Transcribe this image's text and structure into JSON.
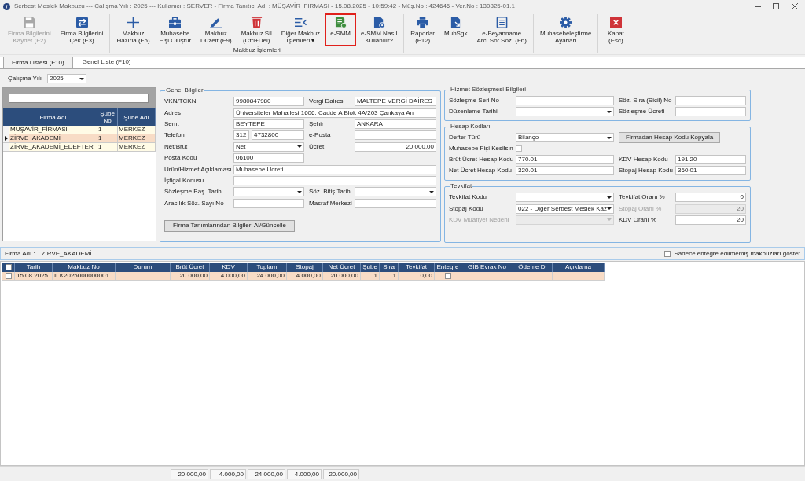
{
  "window": {
    "title": "Serbest Meslek Makbuzu --- Çalışma Yılı : 2025 --- Kullanıcı : SERVER - Firma Tanıtıcı Adı : MÜŞAVİR_FIRMASI - 15.08.2025 - 10:59:42 - Müş.No : 424646 - Ver.No : 130825-01.1"
  },
  "toolbar": {
    "groups": [
      {
        "buttons": [
          {
            "lines": [
              "Firma Bilgilerini",
              "Kaydet (F2)"
            ],
            "disabled": true,
            "highlighted": false
          },
          {
            "lines": [
              "Firma Bilgilerini",
              "Çek (F3)"
            ],
            "disabled": false,
            "highlighted": false
          }
        ]
      },
      {
        "label": "Makbuz İşlemleri",
        "buttons": [
          {
            "lines": [
              "Makbuz",
              "Hazırla (F5)"
            ],
            "disabled": false,
            "highlighted": false
          },
          {
            "lines": [
              "Muhasebe",
              "Fişi Oluştur"
            ],
            "disabled": false,
            "highlighted": false
          },
          {
            "lines": [
              "Makbuz",
              "Düzelt (F9)"
            ],
            "disabled": false,
            "highlighted": false
          },
          {
            "lines": [
              "Makbuz Sil",
              "(Ctrl+Del)"
            ],
            "disabled": false,
            "highlighted": false
          },
          {
            "lines": [
              "Diğer Makbuz",
              "İşlemleri ▾"
            ],
            "disabled": false,
            "highlighted": false
          },
          {
            "lines": [
              "e-SMM"
            ],
            "disabled": false,
            "highlighted": true
          },
          {
            "lines": [
              "e-SMM Nasıl",
              "Kullanılır?"
            ],
            "disabled": false,
            "highlighted": false
          }
        ]
      },
      {
        "buttons": [
          {
            "lines": [
              "Raporlar",
              "(F12)"
            ],
            "disabled": false,
            "highlighted": false
          },
          {
            "lines": [
              "MuhSgk"
            ],
            "disabled": false,
            "highlighted": false
          },
          {
            "lines": [
              "e-Beyanname",
              "Arc. Sor.Söz. (F6)"
            ],
            "disabled": false,
            "highlighted": false
          }
        ]
      },
      {
        "buttons": [
          {
            "lines": [
              "Muhasebeleştirme",
              "Ayarları"
            ],
            "disabled": false,
            "highlighted": false
          }
        ]
      },
      {
        "buttons": [
          {
            "lines": [
              "Kapat",
              "(Esc)"
            ],
            "disabled": false,
            "highlighted": false
          }
        ]
      }
    ]
  },
  "tabs": [
    {
      "label": "Firma Listesi (F10)",
      "selected": true
    },
    {
      "label": "Genel Liste (F10)",
      "selected": false
    }
  ],
  "year_filter": {
    "label": "Çalışma Yılı",
    "value": "2025"
  },
  "firm_list": {
    "columns": [
      "Firma Adı",
      "Şube No",
      "Şube Adı"
    ],
    "rows": [
      {
        "cells": [
          "MÜŞAVİR_FİRMASI",
          "1",
          "MERKEZ"
        ],
        "selected": false
      },
      {
        "cells": [
          "ZİRVE_AKADEMİ",
          "1",
          "MERKEZ"
        ],
        "selected": true
      },
      {
        "cells": [
          "ZİRVE_AKADEMİ_EDEFTER",
          "1",
          "MERKEZ"
        ],
        "selected": false
      }
    ]
  },
  "general_info": {
    "title": "Genel Bilgiler",
    "rows": [
      [
        {
          "label": "VKN/TCKN",
          "kind": "text",
          "value": "9980847980"
        },
        {
          "label": "Vergi Dairesi",
          "kind": "text",
          "value": "MALTEPE VERGİ DAİRES"
        }
      ],
      [
        {
          "label": "Adres",
          "kind": "text",
          "value": "Üniversiteler Mahallesi 1606. Cadde A Blok 4A/203 Çankaya An"
        }
      ],
      [
        {
          "label": "Semt",
          "kind": "text",
          "value": "BEYTEPE"
        },
        {
          "label": "Şehir",
          "kind": "text",
          "value": "ANKARA"
        }
      ],
      [
        {
          "label": "Telefon",
          "kind": "phone",
          "area_code": "312",
          "value": "4732800"
        },
        {
          "label": "e-Posta",
          "kind": "text"
        }
      ],
      [
        {
          "label": "Net/Brüt",
          "kind": "combo",
          "value": "Net"
        },
        {
          "label": "Ücret",
          "kind": "number",
          "value": "20.000,00"
        }
      ],
      [
        {
          "label": "Posta Kodu",
          "kind": "text",
          "value": "06100"
        }
      ],
      [
        {
          "label": "Ürün/Hizmet Açıklaması",
          "kind": "text",
          "value": "Muhasebe Ücreti"
        }
      ],
      [
        {
          "label": "İştigal Konusu",
          "kind": "text"
        }
      ],
      [
        {
          "label": "Sözleşme Baş. Tarihi",
          "kind": "combo"
        },
        {
          "label": "Söz. Bitiş Tarihi",
          "kind": "combo"
        }
      ],
      [
        {
          "label": "Aracılık Söz. Sayı No",
          "kind": "text"
        },
        {
          "label": "Masraf Merkezi",
          "kind": "text"
        }
      ]
    ],
    "button": "Firma Tanımlarından Bilgileri Al/Güncelle"
  },
  "service_contract": {
    "title": "Hizmet Sözleşmesi Bilgileri",
    "rows": [
      [
        {
          "label": "Sözleşme Seri No",
          "kind": "text"
        },
        {
          "label": "Söz. Sıra (Sicil) No",
          "kind": "text"
        }
      ],
      [
        {
          "label": "Düzenleme Tarihi",
          "kind": "combo"
        },
        {
          "label": "Sözleşme Ücreti",
          "kind": "text"
        }
      ]
    ]
  },
  "account_codes": {
    "title": "Hesap Kodları",
    "rows": [
      [
        {
          "label": "Defter Türü",
          "kind": "combo",
          "value": "Bilanço"
        },
        {
          "label": "Firmadan Hesap Kodu Kopyala",
          "kind": "button"
        }
      ],
      [
        {
          "label": "Muhasebe Fişi Kesilsin",
          "kind": "checkbox",
          "checked": false
        }
      ],
      [
        {
          "label": "Brüt Ücret Hesap Kodu",
          "kind": "text",
          "value": "770.01"
        },
        {
          "label": "KDV Hesap Kodu",
          "kind": "text",
          "value": "191.20"
        }
      ],
      [
        {
          "label": "Net Ücret Hesap Kodu",
          "kind": "text",
          "value": "320.01"
        },
        {
          "label": "Stopaj Hesap Kodu",
          "kind": "text",
          "value": "360.01"
        }
      ]
    ]
  },
  "withholding": {
    "title": "Tevkifat",
    "rows": [
      [
        {
          "label": "Tevkifat Kodu",
          "kind": "combo",
          "disabled": false
        },
        {
          "label": "Tevkifat Oranı %",
          "kind": "number",
          "value": "0",
          "disabled": false
        }
      ],
      [
        {
          "label": "Stopaj Kodu",
          "kind": "combo",
          "value": "022 - Diğer Serbest Meslek Kaz",
          "disabled": false
        },
        {
          "label": "Stopaj Oranı %",
          "kind": "number",
          "value": "20",
          "disabled": true
        }
      ],
      [
        {
          "label": "KDV Muafiyet Nedeni",
          "kind": "combo",
          "disabled": true
        },
        {
          "label": "KDV Oranı %",
          "kind": "number",
          "value": "20",
          "disabled": false
        }
      ]
    ]
  },
  "receipts": {
    "firm_label": "Firma Adı :",
    "firm_name": "ZİRVE_AKADEMİ",
    "filter": {
      "label": "Sadece entegre edilmemiş makbuzları göster",
      "checked": false
    },
    "select_all": {
      "checked": false
    },
    "columns": [
      {
        "label": "Tarih",
        "kind": "text"
      },
      {
        "label": "Makbuz No",
        "kind": "text"
      },
      {
        "label": "Durum",
        "kind": "text"
      },
      {
        "label": "Brüt Ücret",
        "kind": "number"
      },
      {
        "label": "KDV",
        "kind": "number"
      },
      {
        "label": "Toplam",
        "kind": "number"
      },
      {
        "label": "Stopaj",
        "kind": "number"
      },
      {
        "label": "Net Ücret",
        "kind": "number"
      },
      {
        "label": "Şube",
        "kind": "number"
      },
      {
        "label": "Sıra",
        "kind": "number"
      },
      {
        "label": "Tevkifat",
        "kind": "number"
      },
      {
        "label": "Entegre",
        "kind": "check"
      },
      {
        "label": "GİB Evrak No",
        "kind": "text"
      },
      {
        "label": "Ödeme D.",
        "kind": "text"
      },
      {
        "label": "Açıklama",
        "kind": "text"
      }
    ],
    "rows": [
      {
        "checked": false,
        "selected": true,
        "cells": [
          "15.08.2025",
          "ILK2025000000001",
          null,
          "20.000,00",
          "4.000,00",
          "24.000,00",
          "4.000,00",
          "20.000,00",
          "1",
          "1",
          "0,00",
          false,
          null,
          null,
          null
        ]
      }
    ],
    "totals": [
      "20.000,00",
      "4.000,00",
      "24.000,00",
      "4.000,00",
      "20.000,00"
    ]
  }
}
